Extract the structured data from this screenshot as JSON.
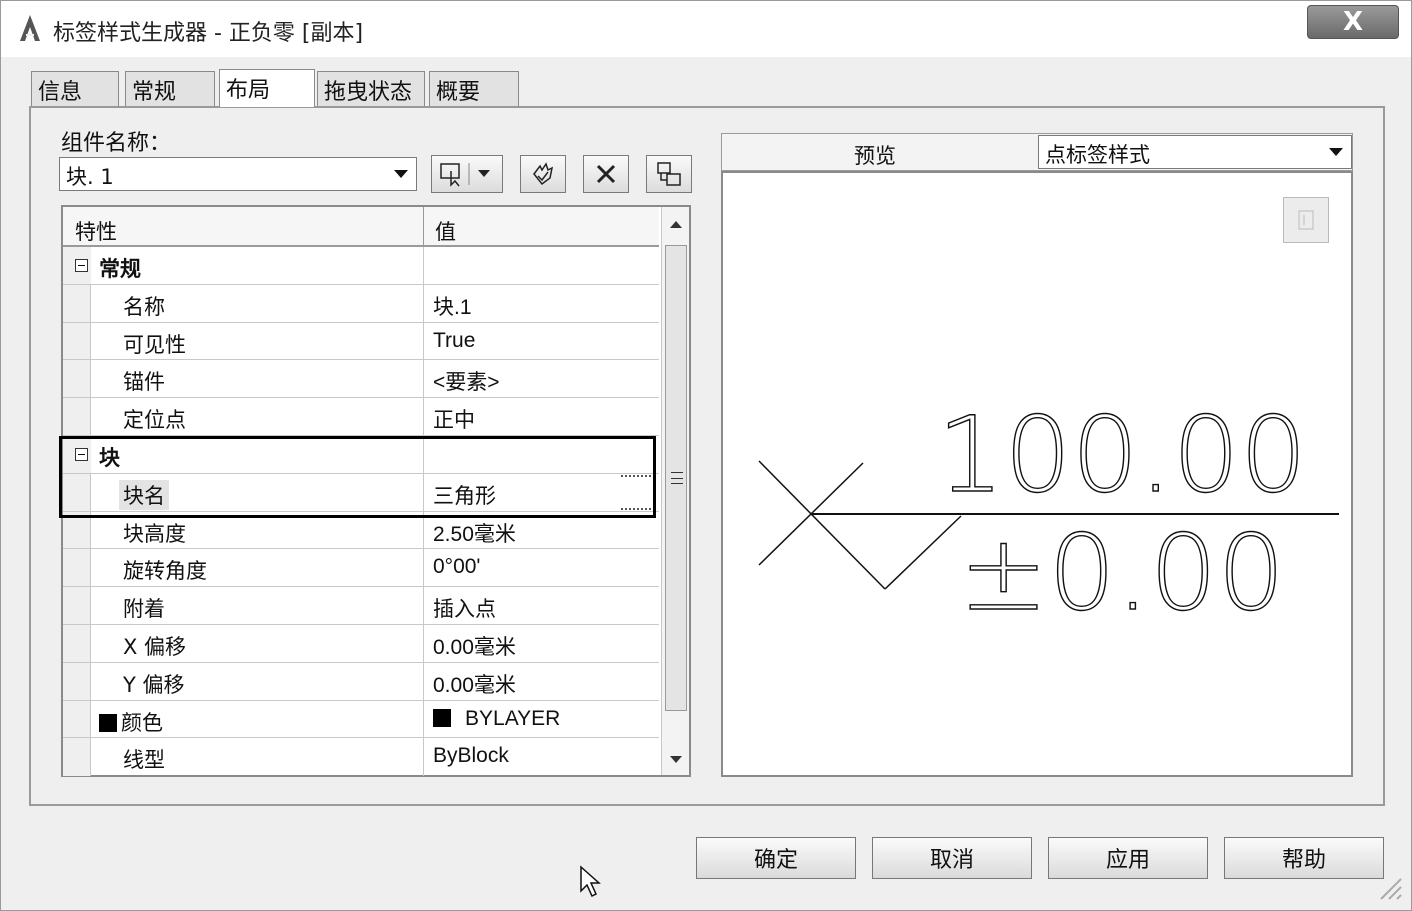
{
  "window": {
    "title": "标签样式生成器 - 正负零 [副本]",
    "close_label": "X"
  },
  "tabs": [
    {
      "label": "信息",
      "active": false
    },
    {
      "label": "常规",
      "active": false
    },
    {
      "label": "布局",
      "active": true
    },
    {
      "label": "拖曳状态",
      "active": false
    },
    {
      "label": "概要",
      "active": false
    }
  ],
  "component": {
    "label": "组件名称：",
    "selected": "块. 1"
  },
  "grid": {
    "col_property": "特性",
    "col_value": "值",
    "rows": [
      {
        "type": "category",
        "name": "常规",
        "value": ""
      },
      {
        "type": "prop",
        "name": "名称",
        "value": "块.1"
      },
      {
        "type": "prop",
        "name": "可见性",
        "value": "True"
      },
      {
        "type": "prop",
        "name": "锚件",
        "value": "<要素>"
      },
      {
        "type": "prop",
        "name": "定位点",
        "value": "正中"
      },
      {
        "type": "category",
        "name": "块",
        "value": ""
      },
      {
        "type": "prop",
        "name": "块名",
        "value": "三角形"
      },
      {
        "type": "prop",
        "name": "块高度",
        "value": "2.50毫米"
      },
      {
        "type": "prop",
        "name": "旋转角度",
        "value": "0°00'"
      },
      {
        "type": "prop",
        "name": "附着",
        "value": "插入点"
      },
      {
        "type": "prop",
        "name": "X 偏移",
        "value": "0.00毫米"
      },
      {
        "type": "prop",
        "name": "Y 偏移",
        "value": "0.00毫米"
      },
      {
        "type": "prop",
        "name": "颜色",
        "value": "BYLAYER",
        "swatch": "#000000"
      },
      {
        "type": "prop",
        "name": "线型",
        "value": "ByBlock"
      }
    ]
  },
  "preview": {
    "label": "预览",
    "style_selected": "点标签样式",
    "label_top": "100.00",
    "label_bottom": "±0.00"
  },
  "buttons": {
    "ok": "确定",
    "cancel": "取消",
    "apply": "应用",
    "help": "帮助"
  }
}
